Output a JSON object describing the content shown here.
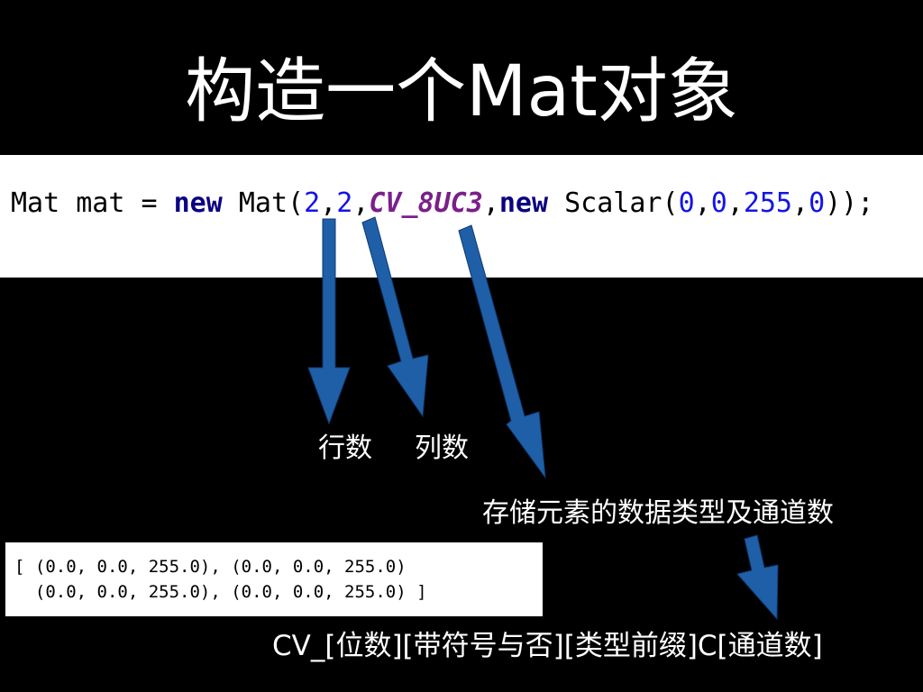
{
  "title": "构造一个Mat对象",
  "code": {
    "prefix": "Mat mat = ",
    "new1": "new",
    "mat_open": " Mat(",
    "rows": "2",
    "comma1": ",",
    "cols": "2",
    "comma2": ",",
    "type": "CV_8UC3",
    "comma3": ",",
    "new2": "new",
    "scalar_open": " Scalar(",
    "s0": "0",
    "c4": ",",
    "s1": "0",
    "c5": ",",
    "s2": "255",
    "c6": ",",
    "s3": "0",
    "closing": "));"
  },
  "labels": {
    "rows": "行数",
    "cols": "列数",
    "type": "存储元素的数据类型及通道数",
    "format": "CV_[位数][带符号与否][类型前缀]C[通道数]"
  },
  "output": [
    "[ (0.0, 0.0, 255.0), (0.0, 0.0, 255.0)",
    "  (0.0, 0.0, 255.0), (0.0, 0.0, 255.0) ]"
  ],
  "colors": {
    "background": "#000000",
    "arrow": "#1f5fa8",
    "keyword": "#0b0080",
    "number": "#1414e6",
    "constant": "#7a1f8a"
  }
}
